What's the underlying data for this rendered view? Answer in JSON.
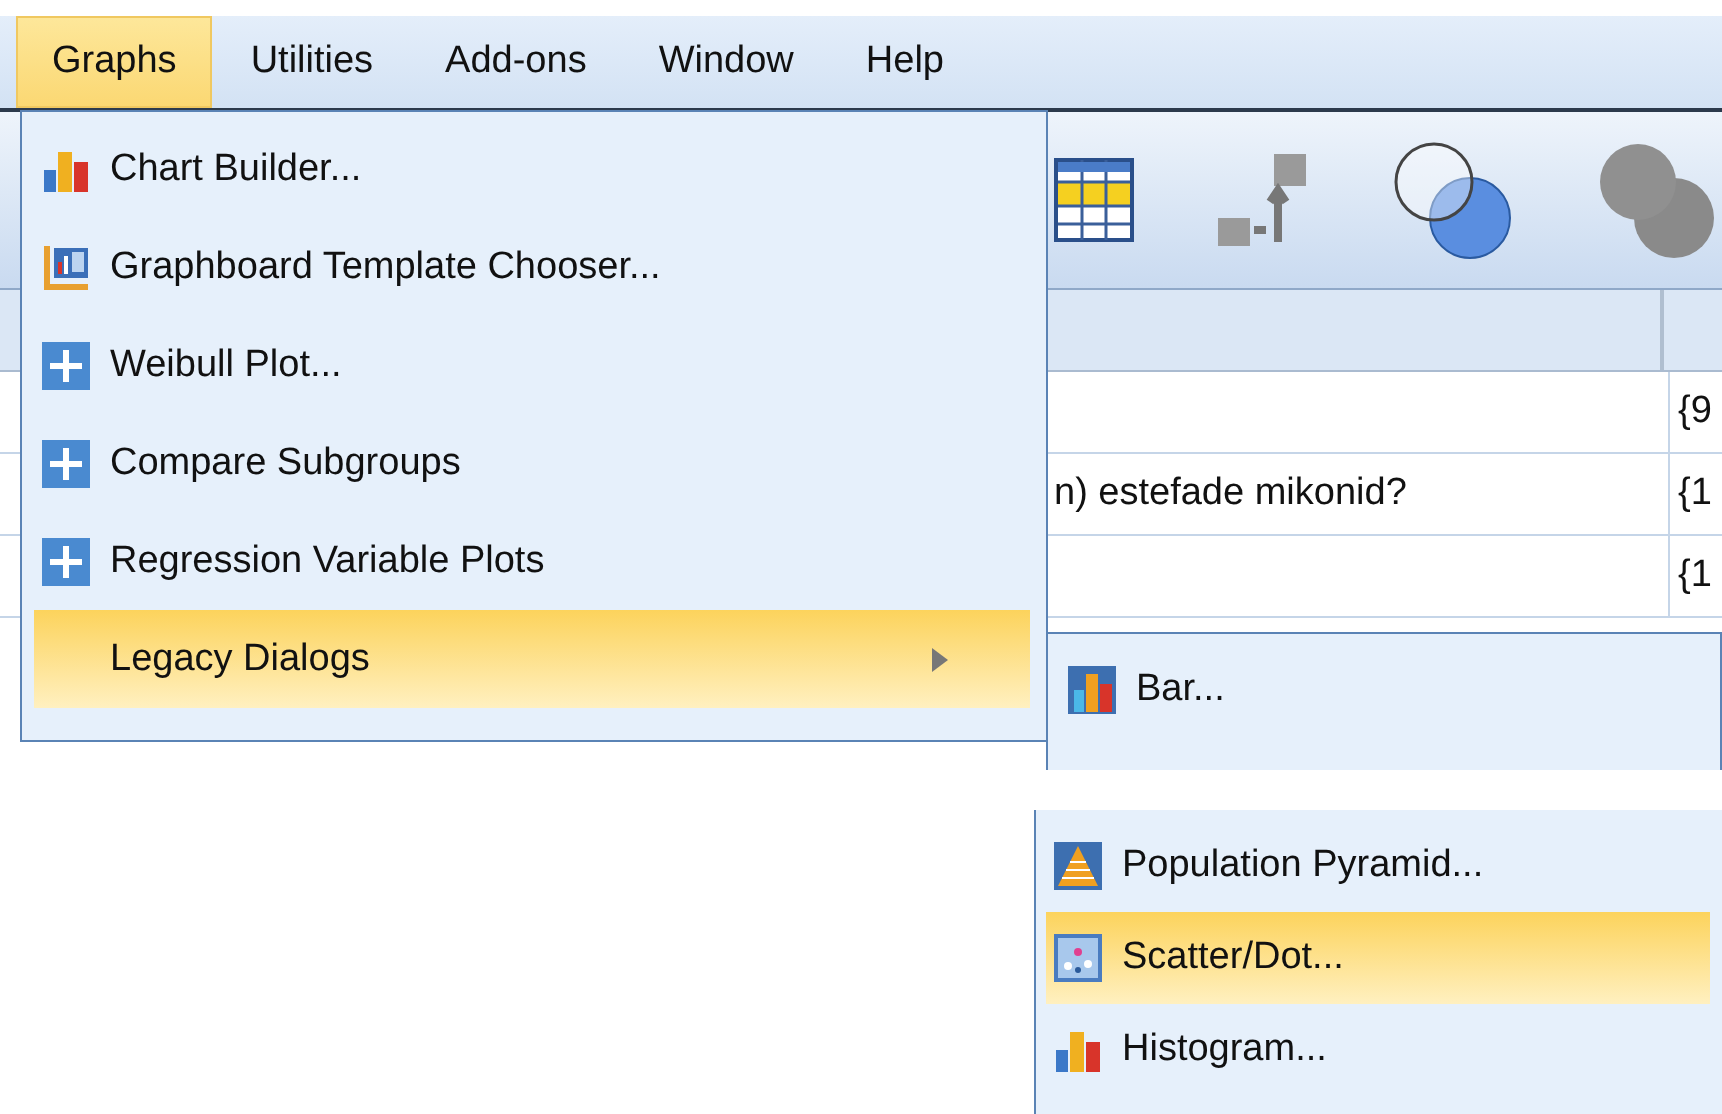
{
  "menubar": [
    {
      "label": "Graphs",
      "selected": true
    },
    {
      "label": "Utilities",
      "selected": false
    },
    {
      "label": "Add-ons",
      "selected": false
    },
    {
      "label": "Window",
      "selected": false
    },
    {
      "label": "Help",
      "selected": false
    }
  ],
  "table": {
    "rows": [
      {
        "column_2": "{9"
      },
      {
        "column_1": "n) estefade mikonid?",
        "column_2": "{1"
      },
      {
        "column_2": "{1"
      }
    ]
  },
  "menu": {
    "items": [
      {
        "label": "Chart Builder...",
        "kind": "chart",
        "selected": false,
        "submenu": false
      },
      {
        "label": "Graphboard Template Chooser...",
        "kind": "graphboard",
        "selected": false,
        "submenu": false
      },
      {
        "label": "Weibull Plot...",
        "kind": "plus",
        "selected": false,
        "submenu": false
      },
      {
        "label": "Compare Subgroups",
        "kind": "plus",
        "selected": false,
        "submenu": false
      },
      {
        "label": "Regression Variable Plots",
        "kind": "plus",
        "selected": false,
        "submenu": false
      },
      {
        "label": "Legacy Dialogs",
        "kind": "none",
        "selected": true,
        "submenu": true
      }
    ]
  },
  "submenu_top": {
    "items": [
      {
        "label": "Bar...",
        "kind": "bar",
        "selected": false
      }
    ]
  },
  "submenu_bottom": {
    "items": [
      {
        "label": "Population Pyramid...",
        "kind": "pyramid",
        "selected": false
      },
      {
        "label": "Scatter/Dot...",
        "kind": "scatter",
        "selected": true
      },
      {
        "label": "Histogram...",
        "kind": "histogram",
        "selected": false
      }
    ]
  }
}
